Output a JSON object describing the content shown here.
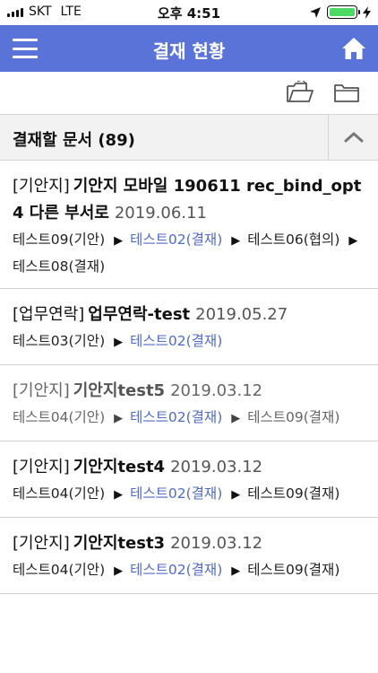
{
  "status_bar": {
    "carrier": "SKT",
    "network": "LTE",
    "time": "오후 4:51"
  },
  "header": {
    "title": "결재 현황",
    "menu_icon": "hamburger-icon",
    "home_icon": "home-icon"
  },
  "toolbar": {
    "icons": [
      "open-folder-icon",
      "folder-icon"
    ]
  },
  "section": {
    "title": "결재할 문서 (89)",
    "collapse_icon": "chevron-up-icon"
  },
  "documents": [
    {
      "type": "[기안지]",
      "title": "기안지 모바일 190611 rec_bind_opt 4 다른 부서로",
      "date": "2019.06.11",
      "muted": false,
      "steps": [
        {
          "label": "테스트09(기안)",
          "current": false
        },
        {
          "label": "테스트02(결재)",
          "current": true
        },
        {
          "label": "테스트06(협의)",
          "current": false
        },
        {
          "label": "테스트08(결재)",
          "current": false
        }
      ]
    },
    {
      "type": "[업무연락]",
      "title": "업무연락-test",
      "date": "2019.05.27",
      "muted": false,
      "steps": [
        {
          "label": "테스트03(기안)",
          "current": false
        },
        {
          "label": "테스트02(결재)",
          "current": true
        }
      ]
    },
    {
      "type": "[기안지]",
      "title": "기안지test5",
      "date": "2019.03.12",
      "muted": true,
      "steps": [
        {
          "label": "테스트04(기안)",
          "current": false
        },
        {
          "label": "테스트02(결재)",
          "current": true
        },
        {
          "label": "테스트09(결재)",
          "current": false
        }
      ]
    },
    {
      "type": "[기안지]",
      "title": "기안지test4",
      "date": "2019.03.12",
      "muted": false,
      "steps": [
        {
          "label": "테스트04(기안)",
          "current": false
        },
        {
          "label": "테스트02(결재)",
          "current": true
        },
        {
          "label": "테스트09(결재)",
          "current": false
        }
      ]
    },
    {
      "type": "[기안지]",
      "title": "기안지test3",
      "date": "2019.03.12",
      "muted": false,
      "steps": [
        {
          "label": "테스트04(기안)",
          "current": false
        },
        {
          "label": "테스트02(결재)",
          "current": true
        },
        {
          "label": "테스트09(결재)",
          "current": false
        }
      ]
    }
  ],
  "colors": {
    "header_bg": "#5a73d8",
    "current_step": "#4f6bc8",
    "section_bg": "#f2f2f2",
    "battery": "#4cd964"
  }
}
